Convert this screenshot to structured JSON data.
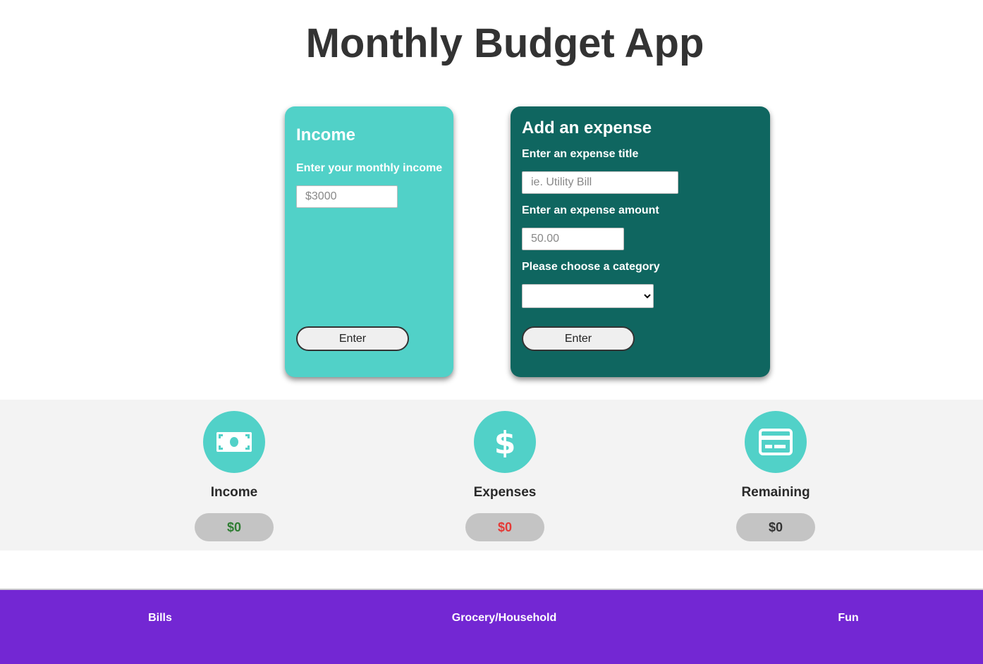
{
  "title": "Monthly Budget App",
  "income_card": {
    "heading": "Income",
    "label": "Enter your monthly income",
    "placeholder": "$3000",
    "button": "Enter"
  },
  "expense_card": {
    "heading": "Add an expense",
    "title_label": "Enter an expense title",
    "title_placeholder": "ie. Utility Bill",
    "amount_label": "Enter an expense amount",
    "amount_placeholder": "50.00",
    "category_label": "Please choose a category",
    "category_selected": "",
    "button": "Enter"
  },
  "summary": {
    "income": {
      "label": "Income",
      "value": "$0",
      "color": "#2e7d32",
      "icon": "cash-icon"
    },
    "expenses": {
      "label": "Expenses",
      "value": "$0",
      "color": "#e53935",
      "icon": "dollar-icon"
    },
    "remaining": {
      "label": "Remaining",
      "value": "$0",
      "color": "#333333",
      "icon": "credit-card-icon"
    }
  },
  "categories": [
    "Bills",
    "Grocery/Household",
    "Fun"
  ],
  "colors": {
    "accent": "#51d1c8",
    "expense_card": "#0f6660",
    "footer": "#7327d3"
  }
}
